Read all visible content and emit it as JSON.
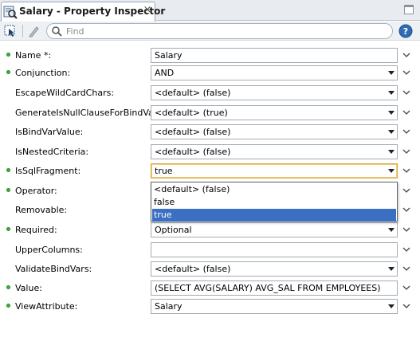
{
  "tab": {
    "title": "Salary - Property Inspector",
    "close_glyph": "×"
  },
  "toolbar": {
    "search_placeholder": "Find",
    "help_label": "?"
  },
  "properties": [
    {
      "label": "Name *:",
      "required": true,
      "kind": "text",
      "value": "Salary"
    },
    {
      "label": "Conjunction:",
      "required": true,
      "kind": "combo",
      "value": "AND"
    },
    {
      "label": "EscapeWildCardChars:",
      "required": false,
      "kind": "combo",
      "value": "<default> (false)"
    },
    {
      "label": "GenerateIsNullClauseForBindVars:",
      "required": false,
      "kind": "combo",
      "value": "<default> (true)"
    },
    {
      "label": "IsBindVarValue:",
      "required": false,
      "kind": "combo",
      "value": "<default> (false)"
    },
    {
      "label": "IsNestedCriteria:",
      "required": false,
      "kind": "combo",
      "value": "<default> (false)"
    },
    {
      "label": "IsSqlFragment:",
      "required": true,
      "kind": "combo",
      "value": "true",
      "focused": true
    },
    {
      "label": "Operator:",
      "required": true,
      "kind": "combo",
      "value": ""
    },
    {
      "label": "Removable:",
      "required": false,
      "kind": "combo",
      "value": ""
    },
    {
      "label": "Required:",
      "required": true,
      "kind": "combo",
      "value": "Optional"
    },
    {
      "label": "UpperColumns:",
      "required": false,
      "kind": "text",
      "value": ""
    },
    {
      "label": "ValidateBindVars:",
      "required": false,
      "kind": "combo",
      "value": "<default> (false)"
    },
    {
      "label": "Value:",
      "required": true,
      "kind": "text",
      "value": "(SELECT AVG(SALARY) AVG_SAL FROM EMPLOYEES)"
    },
    {
      "label": "ViewAttribute:",
      "required": true,
      "kind": "combo",
      "value": "Salary"
    }
  ],
  "dropdown": {
    "options": [
      "<default> (false)",
      "false",
      "true"
    ],
    "selected_index": 2
  },
  "colors": {
    "required_dot": "#3bb23b",
    "selection": "#3b6fc2",
    "focus_border": "#d6a23a"
  }
}
